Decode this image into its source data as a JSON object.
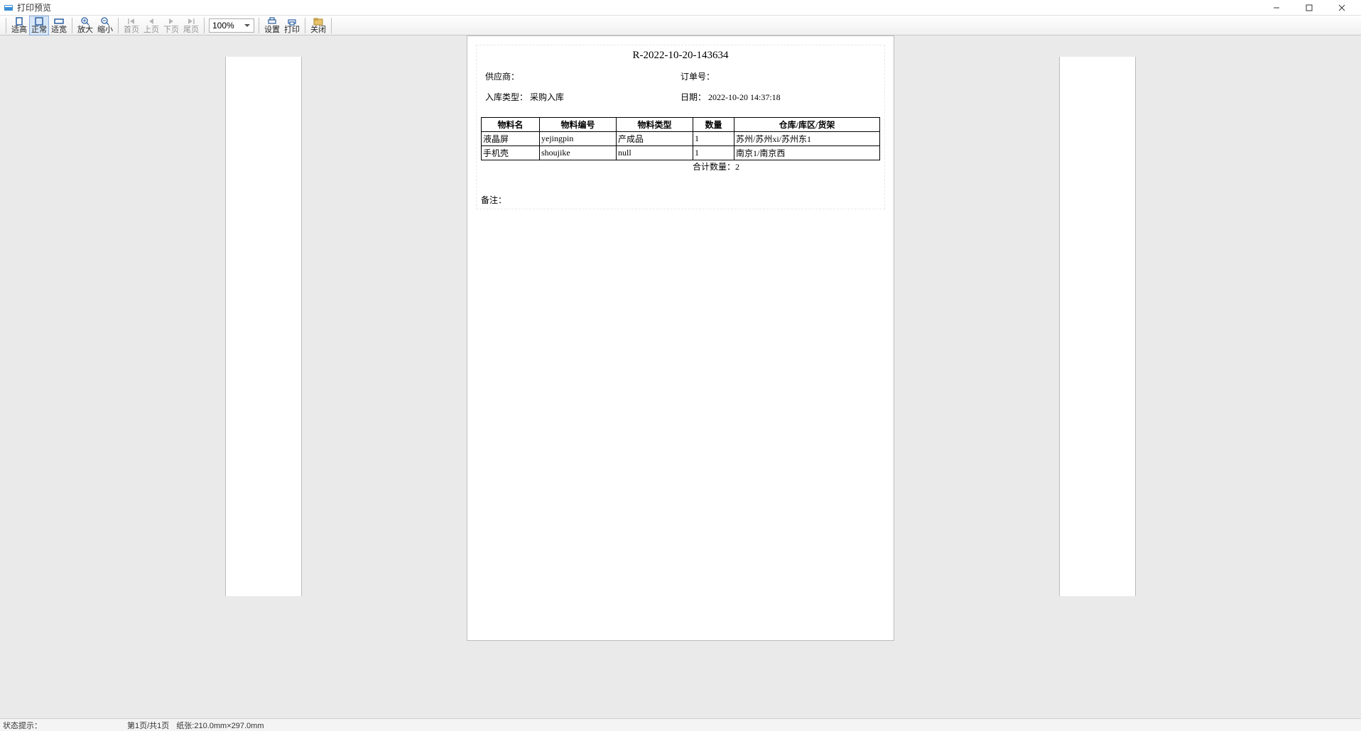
{
  "window": {
    "title": "打印预览"
  },
  "toolbar": {
    "fit_height": "适高",
    "normal": "正常",
    "fit_width": "适宽",
    "zoom_in": "放大",
    "zoom_out": "缩小",
    "first_page": "首页",
    "prev_page": "上页",
    "next_page": "下页",
    "last_page": "尾页",
    "zoom_value": "100%",
    "settings": "设置",
    "print": "打印",
    "close": "关闭"
  },
  "document": {
    "title": "R-2022-10-20-143634",
    "supplier_label": "供应商：",
    "supplier_value": "",
    "order_label": "订单号：",
    "order_value": "",
    "in_type_label": "入库类型：",
    "in_type_value": "采购入库",
    "date_label": "日期：",
    "date_value": "2022-10-20 14:37:18",
    "table": {
      "headers": {
        "name": "物料名",
        "code": "物料编号",
        "type": "物料类型",
        "qty": "数量",
        "location": "仓库/库区/货架"
      },
      "rows": [
        {
          "name": "液晶屏",
          "code": "yejingpin",
          "type": "产成品",
          "qty": "1",
          "location": "苏州/苏州xi/苏州东1"
        },
        {
          "name": "手机壳",
          "code": "shoujike",
          "type": "null",
          "qty": "1",
          "location": "南京1/南京西"
        }
      ],
      "total_label": "合计数量：",
      "total_value": "2"
    },
    "remark_label": "备注："
  },
  "status": {
    "hint_label": "状态提示：",
    "page_info": "第1页/共1页",
    "paper_label": "纸张:",
    "paper_value": "210.0mm×297.0mm"
  }
}
